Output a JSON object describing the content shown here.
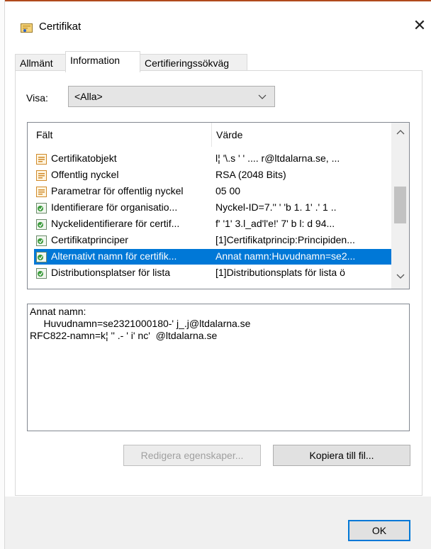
{
  "window": {
    "title": "Certifikat",
    "close_glyph": "✕"
  },
  "tabs": [
    {
      "label": "Allmänt",
      "active": false
    },
    {
      "label": "Information",
      "active": true
    },
    {
      "label": "Certifieringssökväg",
      "active": false
    }
  ],
  "show": {
    "label": "Visa:",
    "selected": "<Alla>"
  },
  "list": {
    "columns": [
      "Fält",
      "Värde"
    ],
    "rows": [
      {
        "field": "Certifikatobjekt",
        "value": "l¦ '\\.s  ' ' .... r@ltdalarna.se, ...",
        "icon": "certificate-field-icon"
      },
      {
        "field": "Offentlig nyckel",
        "value": "RSA (2048 Bits)",
        "icon": "certificate-field-icon"
      },
      {
        "field": "Parametrar för offentlig nyckel",
        "value": "05 00",
        "icon": "certificate-field-icon"
      },
      {
        "field": "Identifierare för organisatio...",
        "value": "Nyckel-ID=7.'' ' 'b  1.  1'  .' 1 ..",
        "icon": "extension-icon"
      },
      {
        "field": "Nyckelidentifierare för certif...",
        "value": "f' '1' 3.l_ad'l'e!' 7' b  l:  d  94...",
        "icon": "extension-icon"
      },
      {
        "field": "Certifikatprinciper",
        "value": "[1]Certifikatprincip:Principiden...",
        "icon": "extension-icon"
      },
      {
        "field": "Alternativt namn för certifik...",
        "value": "Annat namn:Huvudnamn=se2...",
        "icon": "extension-icon",
        "selected": true
      },
      {
        "field": "Distributionsplatser för lista",
        "value": "[1]Distributionsplats för lista ö",
        "icon": "extension-icon"
      }
    ]
  },
  "detail": {
    "lines": [
      "Annat namn:",
      "     Huvudnamn=se2321000180-' j_.j@ltdalarna.se",
      "RFC822-namn=k¦ '' .- ' i' nc'  @ltdalarna.se"
    ]
  },
  "buttons": {
    "edit_properties": "Redigera egenskaper...",
    "copy_to_file": "Kopiera till fil...",
    "ok": "OK"
  },
  "colors": {
    "selection": "#0078d7",
    "accent_top": "#b04a1c"
  }
}
